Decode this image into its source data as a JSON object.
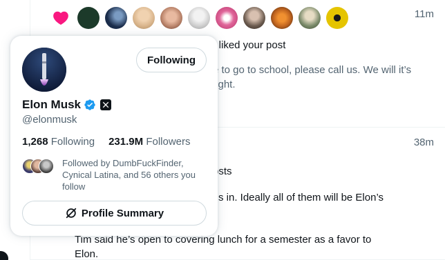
{
  "notifications": [
    {
      "time": "11m",
      "action_text": "rs liked your post",
      "post_text": "e to go to school, please call us. We will it’s tight.",
      "liker_avatars": [
        "#1c3a2a",
        "#1a2c4a",
        "#d9b58c",
        "#b9836a",
        "#c9c9c9",
        "#e0669a",
        "#6b5b4f",
        "#c0641f",
        "#7a8a6a",
        "#e5c400"
      ]
    },
    {
      "time": "38m",
      "action_text": "osts",
      "post_text_a": "s in. Ideally all of them will be Elon’s",
      "post_text_b": "Tim said he’s open to covering lunch for a semester as a favor to Elon."
    }
  ],
  "hover_card": {
    "follow_button": "Following",
    "display_name": "Elon Musk",
    "handle": "@elonmusk",
    "following_count": "1,268",
    "following_label": "Following",
    "followers_count": "231.9M",
    "followers_label": "Followers",
    "followed_by_text": "Followed by DumbFuckFinder, Cynical Latina, and 56 others you follow",
    "summary_button": "Profile Summary"
  },
  "colors": {
    "heart": "#f91880",
    "verified": "#1d9bf0",
    "text_primary": "#0f1419",
    "text_secondary": "#536471",
    "border": "#cfd9de"
  },
  "icons": {
    "like": "heart-icon",
    "verified": "verified-badge-icon",
    "affiliate": "x-logo-icon",
    "summary": "grok-icon"
  }
}
